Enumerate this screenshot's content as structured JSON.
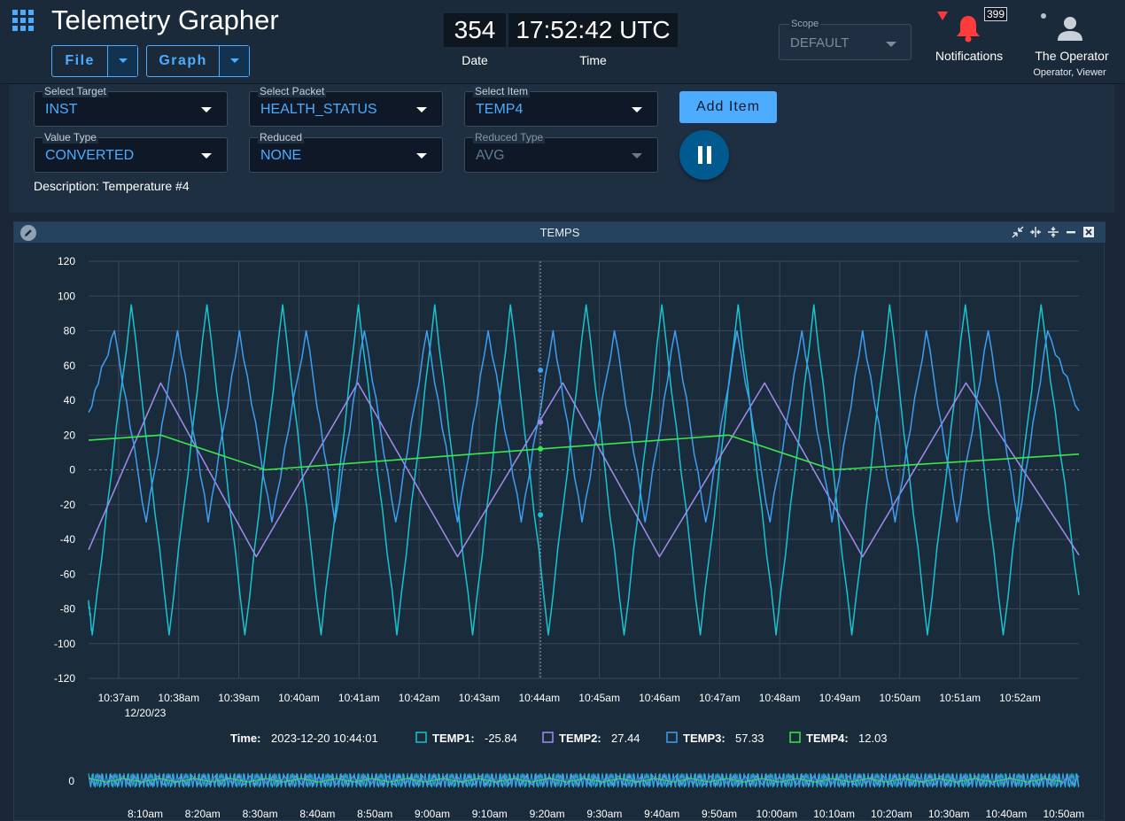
{
  "app": {
    "title": "Telemetry Grapher"
  },
  "menus": {
    "file": "File",
    "graph": "Graph"
  },
  "clock": {
    "date_value": "354",
    "date_label": "Date",
    "time_value": "17:52:42 UTC",
    "time_label": "Time"
  },
  "scope": {
    "label": "Scope",
    "value": "DEFAULT"
  },
  "notifications": {
    "count": "399",
    "label": "Notifications"
  },
  "user": {
    "name": "The Operator",
    "roles": "Operator, Viewer"
  },
  "controls": {
    "target": {
      "label": "Select Target",
      "value": "INST"
    },
    "packet": {
      "label": "Select Packet",
      "value": "HEALTH_STATUS"
    },
    "item": {
      "label": "Select Item",
      "value": "TEMP4"
    },
    "value_type": {
      "label": "Value Type",
      "value": "CONVERTED"
    },
    "reduced": {
      "label": "Reduced",
      "value": "NONE"
    },
    "reduced_type": {
      "label": "Reduced Type",
      "value": "AVG"
    },
    "add_item": "Add Item",
    "description": "Description: Temperature #4"
  },
  "graph": {
    "title": "TEMPS"
  },
  "chart_data": {
    "type": "line",
    "title": "TEMPS",
    "ylim": [
      -120,
      120
    ],
    "y_ticks": [
      120,
      100,
      80,
      60,
      40,
      20,
      0,
      -20,
      -40,
      -60,
      -80,
      -100,
      -120
    ],
    "x_ticks": [
      "10:37am",
      "10:38am",
      "10:39am",
      "10:40am",
      "10:41am",
      "10:42am",
      "10:43am",
      "10:44am",
      "10:45am",
      "10:46am",
      "10:47am",
      "10:48am",
      "10:49am",
      "10:50am",
      "10:51am",
      "10:52am"
    ],
    "x_range_minutes": [
      36.5,
      52.98
    ],
    "date_label": "12/20/23",
    "cursor": {
      "time_label": "Time:",
      "time_value": "2023-12-20 10:44:01",
      "x_minutes": 44.02
    },
    "series": [
      {
        "name": "TEMP1",
        "color": "#19c3cf",
        "cursor_value": "-25.84",
        "points": [
          [
            36.5,
            -75
          ],
          [
            36.56,
            -95
          ],
          [
            37.21,
            95
          ],
          [
            37.84,
            -95
          ],
          [
            38.47,
            95
          ],
          [
            39.1,
            -95
          ],
          [
            39.73,
            95
          ],
          [
            40.37,
            -95
          ],
          [
            40.99,
            95
          ],
          [
            41.63,
            -95
          ],
          [
            42.26,
            95
          ],
          [
            42.89,
            -95
          ],
          [
            43.52,
            95
          ],
          [
            44.15,
            -95
          ],
          [
            44.78,
            95
          ],
          [
            45.41,
            -95
          ],
          [
            46.04,
            95
          ],
          [
            46.68,
            -95
          ],
          [
            47.31,
            95
          ],
          [
            47.94,
            -95
          ],
          [
            48.57,
            95
          ],
          [
            49.2,
            -95
          ],
          [
            49.83,
            95
          ],
          [
            50.46,
            -95
          ],
          [
            51.09,
            95
          ],
          [
            51.72,
            -95
          ],
          [
            52.35,
            95
          ],
          [
            52.98,
            -72
          ]
        ]
      },
      {
        "name": "TEMP2",
        "color": "#a28cf0",
        "cursor_value": "27.44",
        "points": [
          [
            36.5,
            -46
          ],
          [
            37.7,
            50
          ],
          [
            39.29,
            -50
          ],
          [
            40.98,
            50
          ],
          [
            42.64,
            -50
          ],
          [
            44.39,
            50
          ],
          [
            46.0,
            -50
          ],
          [
            47.75,
            50
          ],
          [
            49.38,
            -50
          ],
          [
            51.1,
            50
          ],
          [
            52.98,
            -49
          ]
        ]
      },
      {
        "name": "TEMP3",
        "color": "#3d9ef2",
        "cursor_value": "57.33",
        "points": [
          [
            36.5,
            33
          ],
          [
            36.93,
            80
          ],
          [
            37.46,
            -30
          ],
          [
            37.98,
            80
          ],
          [
            38.49,
            -30
          ],
          [
            39.01,
            80
          ],
          [
            39.55,
            -30
          ],
          [
            40.12,
            80
          ],
          [
            40.6,
            -30
          ],
          [
            41.09,
            80
          ],
          [
            41.61,
            -30
          ],
          [
            42.13,
            80
          ],
          [
            42.64,
            -30
          ],
          [
            43.15,
            80
          ],
          [
            43.7,
            -30
          ],
          [
            44.23,
            80
          ],
          [
            44.71,
            -30
          ],
          [
            45.25,
            80
          ],
          [
            45.76,
            -30
          ],
          [
            46.26,
            80
          ],
          [
            46.77,
            -30
          ],
          [
            47.29,
            80
          ],
          [
            47.84,
            -30
          ],
          [
            48.37,
            80
          ],
          [
            48.87,
            -30
          ],
          [
            49.38,
            80
          ],
          [
            49.92,
            -30
          ],
          [
            50.44,
            80
          ],
          [
            50.95,
            -30
          ],
          [
            51.47,
            80
          ],
          [
            51.97,
            -30
          ],
          [
            52.46,
            80
          ],
          [
            52.98,
            34
          ]
        ]
      },
      {
        "name": "TEMP4",
        "color": "#39e84a",
        "cursor_value": "12.03",
        "points": [
          [
            36.5,
            17
          ],
          [
            37.7,
            20
          ],
          [
            39.44,
            0
          ],
          [
            44.02,
            12
          ],
          [
            47.15,
            20
          ],
          [
            48.89,
            0
          ],
          [
            52.98,
            9
          ]
        ]
      }
    ]
  },
  "overview": {
    "y_tick": "0",
    "x_ticks": [
      "8:10am",
      "8:20am",
      "8:30am",
      "8:40am",
      "8:50am",
      "9:00am",
      "9:10am",
      "9:20am",
      "9:30am",
      "9:40am",
      "9:50am",
      "10:00am",
      "10:10am",
      "10:20am",
      "10:30am",
      "10:40am",
      "10:50am"
    ]
  }
}
